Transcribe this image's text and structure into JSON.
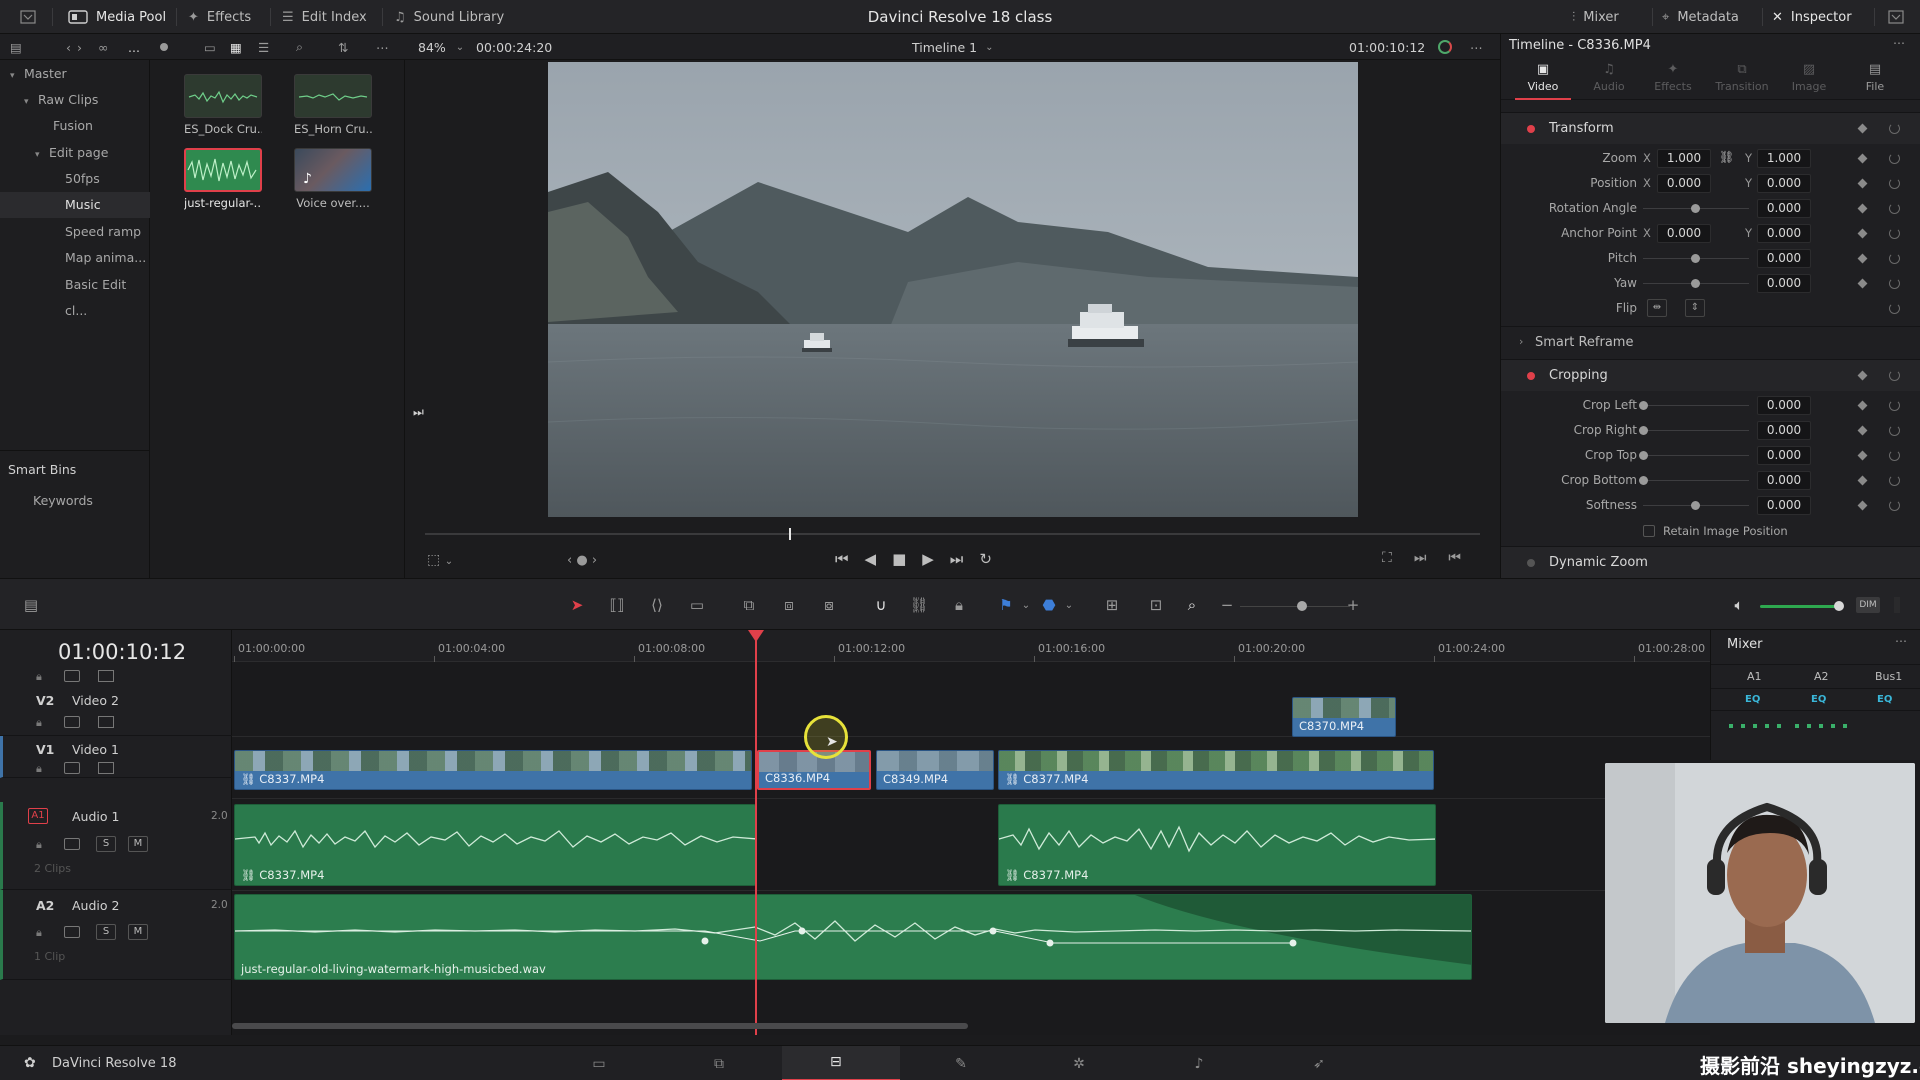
{
  "app": {
    "title": "Davinci Resolve 18 class",
    "product": "DaVinci Resolve 18"
  },
  "topbar": {
    "media_pool": "Media Pool",
    "effects": "Effects",
    "edit_index": "Edit Index",
    "sound_library": "Sound Library",
    "mixer": "Mixer",
    "metadata": "Metadata",
    "inspector": "Inspector"
  },
  "toolbar2": {
    "more": "...",
    "zoom": "84%",
    "source_timecode": "00:00:24:20",
    "timeline_name": "Timeline 1",
    "record_timecode": "01:00:10:12",
    "inspector_title": "Timeline - C8336.MP4"
  },
  "bins": {
    "items": [
      {
        "label": "Master"
      },
      {
        "label": "Raw Clips"
      },
      {
        "label": "Fusion"
      },
      {
        "label": "Edit page"
      },
      {
        "label": "50fps"
      },
      {
        "label": "Music"
      },
      {
        "label": "Speed ramp"
      },
      {
        "label": "Map anima..."
      },
      {
        "label": "Basic Edit cl..."
      }
    ],
    "smart_bins": "Smart Bins",
    "keywords": "Keywords"
  },
  "pool": {
    "clips": [
      {
        "label": "ES_Dock Cru..."
      },
      {
        "label": "ES_Horn Cru..."
      },
      {
        "label": "just-regular-..."
      },
      {
        "label": "Voice over...."
      }
    ]
  },
  "inspector": {
    "tabs": [
      {
        "label": "Video"
      },
      {
        "label": "Audio"
      },
      {
        "label": "Effects"
      },
      {
        "label": "Transition"
      },
      {
        "label": "Image"
      },
      {
        "label": "File"
      }
    ],
    "transform": {
      "title": "Transform",
      "zoom_label": "Zoom",
      "zoom_x": "1.000",
      "zoom_y": "1.000",
      "position_label": "Position",
      "position_x": "0.000",
      "position_y": "0.000",
      "rotation_label": "Rotation Angle",
      "rotation": "0.000",
      "anchor_label": "Anchor Point",
      "anchor_x": "0.000",
      "anchor_y": "0.000",
      "pitch_label": "Pitch",
      "pitch": "0.000",
      "yaw_label": "Yaw",
      "yaw": "0.000",
      "flip_label": "Flip",
      "x": "X",
      "y": "Y"
    },
    "smart_reframe": "Smart Reframe",
    "cropping": {
      "title": "Cropping",
      "crop_left_label": "Crop Left",
      "crop_left": "0.000",
      "crop_right_label": "Crop Right",
      "crop_right": "0.000",
      "crop_top_label": "Crop Top",
      "crop_top": "0.000",
      "crop_bottom_label": "Crop Bottom",
      "crop_bottom": "0.000",
      "softness_label": "Softness",
      "softness": "0.000",
      "retain_label": "Retain Image Position"
    },
    "dynamic_zoom": "Dynamic Zoom"
  },
  "timeline": {
    "timecode": "01:00:10:12",
    "ruler": [
      "01:00:00:00",
      "01:00:04:00",
      "01:00:08:00",
      "01:00:12:00",
      "01:00:16:00",
      "01:00:20:00",
      "01:00:24:00",
      "01:00:28:00"
    ],
    "tracks": {
      "v2": {
        "id": "V2",
        "name": "Video 2"
      },
      "v1": {
        "id": "V1",
        "name": "Video 1"
      },
      "a1": {
        "id": "A1",
        "name": "Audio 1",
        "channels": "2.0",
        "clips": "2 Clips",
        "s": "S",
        "m": "M"
      },
      "a2": {
        "id": "A2",
        "name": "Audio 2",
        "channels": "2.0",
        "clips": "1 Clip",
        "s": "S",
        "m": "M"
      }
    },
    "v2_clips": [
      {
        "name": "C8370.MP4"
      }
    ],
    "v1_clips": [
      {
        "name": "C8337.MP4"
      },
      {
        "name": "C8336.MP4"
      },
      {
        "name": "C8349.MP4"
      },
      {
        "name": "C8377.MP4"
      }
    ],
    "a1_clips": [
      {
        "name": "C8337.MP4"
      },
      {
        "name": "C8377.MP4"
      }
    ],
    "a2_clips": [
      {
        "name": "just-regular-old-living-watermark-high-musicbed.wav"
      }
    ]
  },
  "mixer": {
    "title": "Mixer",
    "channels": [
      "A1",
      "A2",
      "Bus1"
    ],
    "eq": "EQ"
  },
  "volume": {
    "dim": "DIM"
  },
  "watermark": "摄影前沿 sheyingzyz.com",
  "colors": {
    "accent_red": "#e0404a",
    "clip_blue": "#3f73a8",
    "clip_green": "#2a7a4c"
  }
}
